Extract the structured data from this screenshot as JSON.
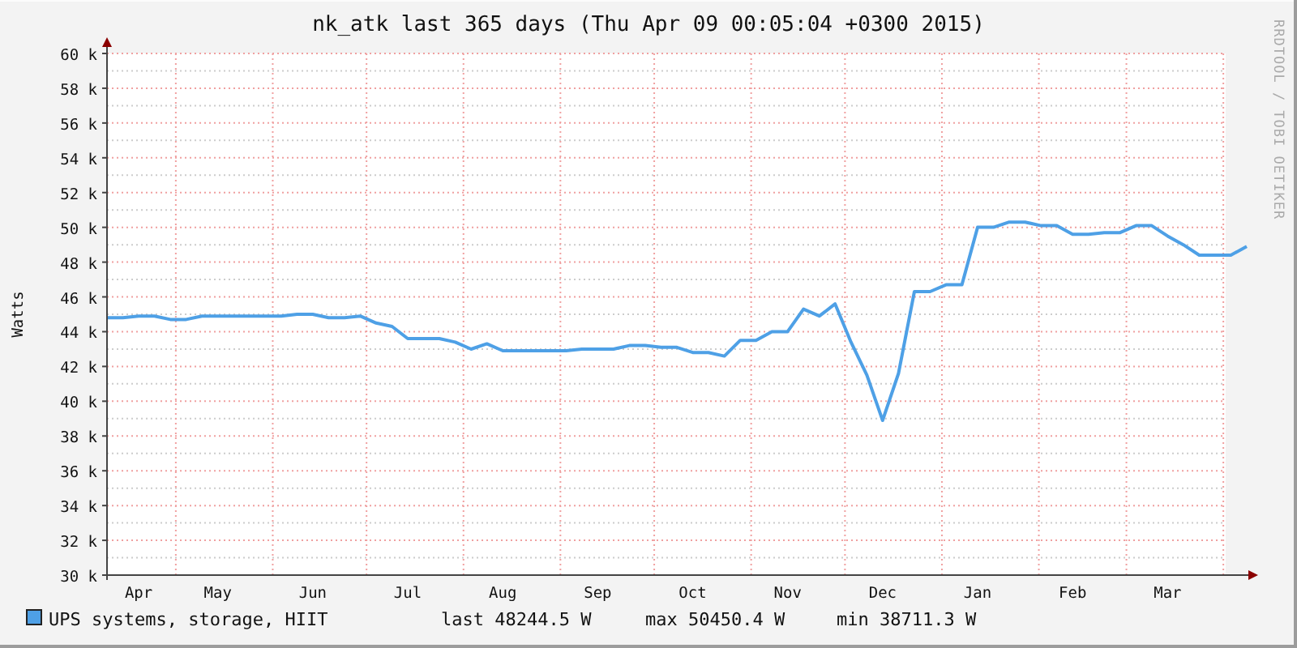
{
  "title": "nk_atk last 365 days (Thu Apr 09 00:05:04 +0300 2015)",
  "side_text": "RRDTOOL / TOBI OETIKER",
  "chart_data": {
    "type": "line",
    "grid": true,
    "ylabel": "Watts",
    "ylim": [
      30000,
      60000
    ],
    "yticks": [
      {
        "value": 30000,
        "label": "30 k"
      },
      {
        "value": 32000,
        "label": "32 k"
      },
      {
        "value": 34000,
        "label": "34 k"
      },
      {
        "value": 36000,
        "label": "36 k"
      },
      {
        "value": 38000,
        "label": "38 k"
      },
      {
        "value": 40000,
        "label": "40 k"
      },
      {
        "value": 42000,
        "label": "42 k"
      },
      {
        "value": 44000,
        "label": "44 k"
      },
      {
        "value": 46000,
        "label": "46 k"
      },
      {
        "value": 48000,
        "label": "48 k"
      },
      {
        "value": 50000,
        "label": "50 k"
      },
      {
        "value": 52000,
        "label": "52 k"
      },
      {
        "value": 54000,
        "label": "54 k"
      },
      {
        "value": 56000,
        "label": "56 k"
      },
      {
        "value": 58000,
        "label": "58 k"
      },
      {
        "value": 60000,
        "label": "60 k"
      }
    ],
    "categories": [
      null,
      null,
      "Apr",
      null,
      null,
      null,
      null,
      "May",
      null,
      null,
      null,
      null,
      null,
      "Jun",
      null,
      null,
      null,
      null,
      null,
      "Jul",
      null,
      null,
      null,
      null,
      null,
      "Aug",
      null,
      null,
      null,
      null,
      null,
      "Sep",
      null,
      null,
      null,
      null,
      null,
      "Oct",
      null,
      null,
      null,
      null,
      null,
      "Nov",
      null,
      null,
      null,
      null,
      null,
      "Dec",
      null,
      null,
      null,
      null,
      null,
      "Jan",
      null,
      null,
      null,
      null,
      null,
      "Feb",
      null,
      null,
      null,
      null,
      null,
      "Mar",
      null,
      null,
      null,
      null,
      null
    ],
    "series": [
      {
        "name": "UPS systems, storage, HIIT",
        "color": "#4ea0e6",
        "values": [
          44800,
          44800,
          44900,
          44900,
          44700,
          44700,
          44900,
          44900,
          44900,
          44900,
          44900,
          44900,
          45000,
          45000,
          44800,
          44800,
          44900,
          44500,
          44300,
          43600,
          43600,
          43600,
          43400,
          43000,
          43300,
          42900,
          42900,
          42900,
          42900,
          42900,
          43000,
          43000,
          43000,
          43200,
          43200,
          43100,
          43100,
          42800,
          42800,
          42600,
          43500,
          43500,
          44000,
          44000,
          45300,
          44900,
          45600,
          43400,
          41500,
          38900,
          41600,
          46300,
          46300,
          46700,
          46700,
          50000,
          50000,
          50300,
          50300,
          50100,
          50100,
          49600,
          49600,
          49700,
          49700,
          50100,
          50100,
          49500,
          49000,
          48400,
          48400,
          48400,
          48900
        ]
      }
    ]
  },
  "legend": {
    "last": "last 48244.5 W",
    "max": "max 50450.4 W",
    "min": "min 38711.3 W"
  }
}
